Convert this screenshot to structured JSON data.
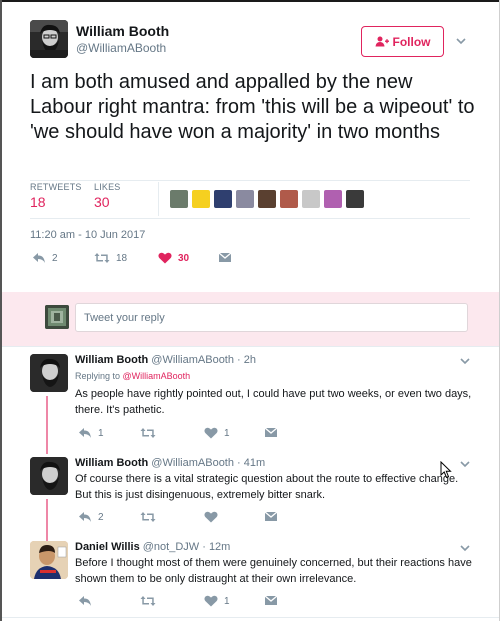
{
  "tweet": {
    "author": {
      "name": "William Booth",
      "handle": "@WilliamABooth"
    },
    "follow_label": "Follow",
    "text": "I am both amused and appalled by the new Labour right mantra: from 'this will be a wipeout' to 'we should have won a majority' in two months",
    "stats": {
      "retweets_label": "RETWEETS",
      "retweets_value": "18",
      "likes_label": "LIKES",
      "likes_value": "30"
    },
    "timestamp": "11:20 am - 10 Jun 2017",
    "actions": {
      "reply_count": "2",
      "retweet_count": "18",
      "like_count": "30"
    }
  },
  "reply_box": {
    "placeholder": "Tweet your reply"
  },
  "replies": [
    {
      "name": "William Booth",
      "handle": "@WilliamABooth · 2h",
      "replying_prefix": "Replying to ",
      "replying_to": "@WilliamABooth",
      "text": "As people have rightly pointed out, I could have put two weeks, or even two days, there. It's pathetic.",
      "reply_count": "1",
      "retweet_count": "",
      "like_count": "1"
    },
    {
      "name": "William Booth",
      "handle": "@WilliamABooth · 41m",
      "text": "Of course there is a vital strategic question about the route to effective change. But this is just disingenuous, extremely bitter snark.",
      "reply_count": "2",
      "retweet_count": "",
      "like_count": ""
    },
    {
      "name": "Daniel Willis",
      "handle": "@not_DJW · 12m",
      "text": "Before I thought most of them were genuinely concerned, but their reactions have shown them to be only distraught at their own irrelevance.",
      "reply_count": "",
      "retweet_count": "",
      "like_count": "1"
    }
  ],
  "colors": {
    "accent": "#e0245e",
    "text_primary": "#14171a",
    "text_secondary": "#657786",
    "reply_band": "#fce8ee",
    "divider": "#e6ecf0"
  },
  "icons": [
    "follow-person-plus-icon",
    "chevron-down-icon",
    "reply-icon",
    "retweet-icon",
    "heart-icon",
    "direct-message-icon",
    "mouse-cursor-icon"
  ]
}
